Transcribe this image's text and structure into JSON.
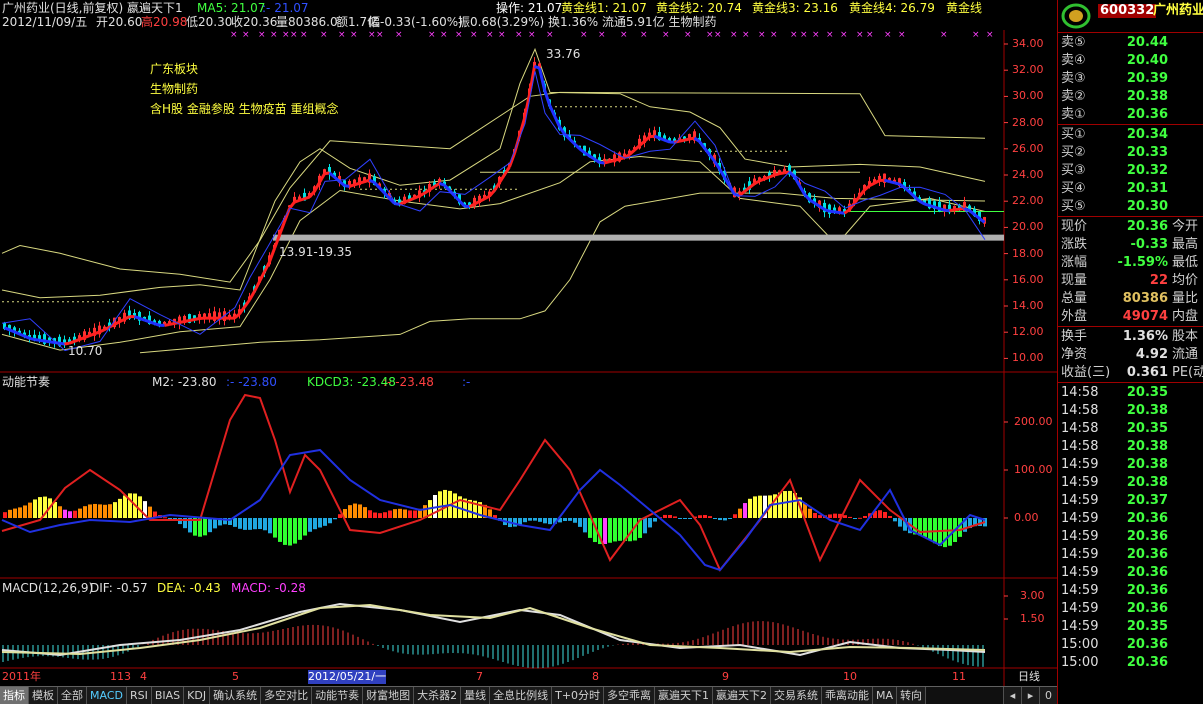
{
  "header": {
    "title": "广州药业(日线,前复权) 嬴遍天下1",
    "ma5_label": "MA5: 21.07",
    "ma5_dash": ":- 21.07",
    "op": "操作: 21.07",
    "g1": "黄金线1: 21.07",
    "g2": "黄金线2: 20.74",
    "g3": "黄金线3: 23.16",
    "g4": "黄金线4: 26.79",
    "g5": "黄金线",
    "info": "2012/11/09/五 开20.60 高20.98 低20.30 收20.36 量80386.0 额1.7亿 幅-0.33(-1.60%) 振0.68(3.29%) 换1.36% 流通5.91亿 生物制药",
    "info_date": "2012/11/09/五",
    "info_open": "开20.60",
    "info_high": "高20.98",
    "info_low": "低20.30",
    "info_close": "收20.36",
    "info_vol": "量80386.0",
    "info_amt": "额1.7亿",
    "info_chg": "幅-0.33(-1.60%)",
    "info_rest": "振0.68(3.29%) 换1.36% 流通5.91亿 生物制药"
  },
  "annotations": {
    "sector": "广东板块",
    "industry": "生物制药",
    "concepts": "含H股 金融参股 生物疫苗 重组概念",
    "peak": "33.76",
    "range": "13.91-19.35",
    "low": "10.70"
  },
  "price_axis": [
    "34.00",
    "32.00",
    "30.00",
    "28.00",
    "26.00",
    "24.00",
    "22.00",
    "20.00",
    "18.00",
    "16.00",
    "14.00",
    "12.00",
    "10.00"
  ],
  "indicator1": {
    "name": "动能节奏",
    "m2": "M2: -23.80",
    "m2_dash": ":- -23.80",
    "kdcd3": "KDCD3: -23.48",
    "kdcd3_dash": ":- -23.48",
    "dash": ":-",
    "axis": [
      "200.00",
      "100.00",
      "0.00"
    ]
  },
  "indicator2": {
    "name": "MACD(12,26,9)",
    "dif": "DIF: -0.57",
    "dea": "DEA: -0.43",
    "macd": "MACD: -0.28",
    "axis": [
      "3.00",
      "1.50"
    ]
  },
  "time_axis": {
    "labels": [
      "2011年",
      "11",
      "3",
      "4",
      "5",
      "2012/05/21/一",
      "7",
      "8",
      "9",
      "10",
      "11"
    ],
    "period": "日线"
  },
  "quote": {
    "code": "600332",
    "name": "广州药业",
    "asks": [
      {
        "label": "卖⑤",
        "price": "20.44"
      },
      {
        "label": "卖④",
        "price": "20.40"
      },
      {
        "label": "卖③",
        "price": "20.39"
      },
      {
        "label": "卖②",
        "price": "20.38"
      },
      {
        "label": "卖①",
        "price": "20.36"
      }
    ],
    "bids": [
      {
        "label": "买①",
        "price": "20.34"
      },
      {
        "label": "买②",
        "price": "20.33"
      },
      {
        "label": "买③",
        "price": "20.32"
      },
      {
        "label": "买④",
        "price": "20.31"
      },
      {
        "label": "买⑤",
        "price": "20.30"
      }
    ],
    "stats": [
      {
        "l1": "现价",
        "v": "20.36",
        "l2": "今开",
        "color": "#40ff40"
      },
      {
        "l1": "涨跌",
        "v": "-0.33",
        "l2": "最高",
        "color": "#40ff40"
      },
      {
        "l1": "涨幅",
        "v": "-1.59%",
        "l2": "最低",
        "color": "#40ff40"
      },
      {
        "l1": "现量",
        "v": "22",
        "l2": "均价",
        "color": "#ff4040"
      },
      {
        "l1": "总量",
        "v": "80386",
        "l2": "量比",
        "color": "#e0c060"
      },
      {
        "l1": "外盘",
        "v": "49074",
        "l2": "内盘",
        "color": "#ff4040"
      }
    ],
    "stats2": [
      {
        "l1": "换手",
        "v": "1.36%",
        "l2": "股本",
        "color": "#e0e0e0"
      },
      {
        "l1": "净资",
        "v": "4.92",
        "l2": "流通",
        "color": "#e0e0e0"
      },
      {
        "l1": "收益(三)",
        "v": "0.361",
        "l2": "PE(动)",
        "color": "#e0e0e0"
      }
    ],
    "ticks": [
      {
        "t": "14:58",
        "p": "20.35"
      },
      {
        "t": "14:58",
        "p": "20.38"
      },
      {
        "t": "14:58",
        "p": "20.35"
      },
      {
        "t": "14:58",
        "p": "20.38"
      },
      {
        "t": "14:59",
        "p": "20.38"
      },
      {
        "t": "14:59",
        "p": "20.38"
      },
      {
        "t": "14:59",
        "p": "20.37"
      },
      {
        "t": "14:59",
        "p": "20.36"
      },
      {
        "t": "14:59",
        "p": "20.36"
      },
      {
        "t": "14:59",
        "p": "20.36"
      },
      {
        "t": "14:59",
        "p": "20.36"
      },
      {
        "t": "14:59",
        "p": "20.36"
      },
      {
        "t": "14:59",
        "p": "20.36"
      },
      {
        "t": "14:59",
        "p": "20.35"
      },
      {
        "t": "15:00",
        "p": "20.36"
      },
      {
        "t": "15:00",
        "p": "20.36"
      }
    ]
  },
  "tabs": [
    "指标",
    "模板",
    "全部",
    "MACD",
    "RSI",
    "BIAS",
    "KDJ",
    "确认系统",
    "多空对比",
    "动能节奏",
    "财富地图",
    "大杀器2",
    "量线",
    "全息比例线",
    "T+0分时",
    "多空乖离",
    "嬴遍天下1",
    "嬴遍天下2",
    "交易系统",
    "乖离动能",
    "MA",
    "转向"
  ],
  "tab_scroll": [
    "◂",
    "▸",
    "0"
  ],
  "colors": {
    "up": "#ff3030",
    "down": "#00e0e0",
    "border": "#a00000",
    "ma_blue": "#2030ff",
    "yellow_line": "#e8e8a0"
  }
}
